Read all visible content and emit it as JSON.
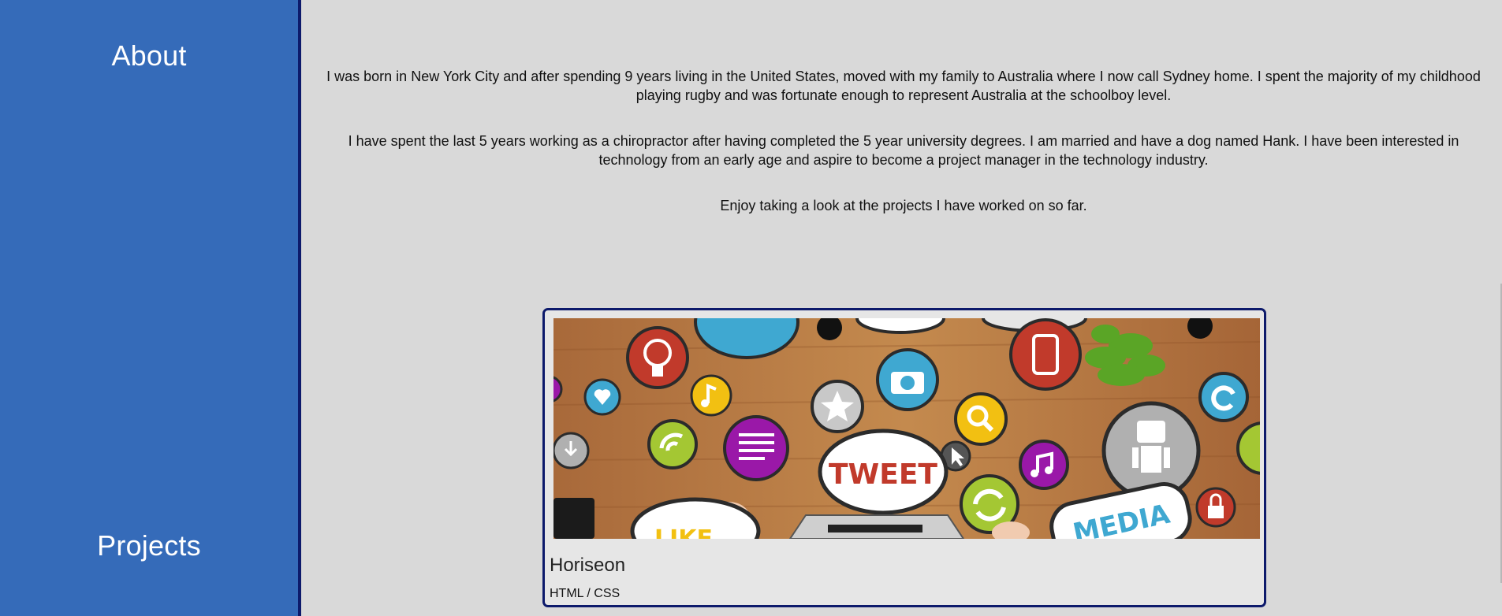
{
  "sidebar": {
    "about_label": "About",
    "projects_label": "Projects"
  },
  "about": {
    "paragraphs": [
      "I was born in New York City and after spending 9 years living in the United States, moved with my family to Australia where I now call Sydney home. I spent the majority of my childhood playing rugby and was fortunate enough to represent Australia at the schoolboy level.",
      "I have spent the last 5 years working as a chiropractor after having completed the 5 year university degrees. I am married and have a dog named Hank. I have been interested in technology from an early age and aspire to become a project manager in the technology industry.",
      "Enjoy taking a look at the projects I have worked on so far."
    ]
  },
  "projects": [
    {
      "title": "Horiseon",
      "tags": "HTML / CSS",
      "image": {
        "icon": "social-media-icons-desk-photo",
        "tweet_text": "TWEET",
        "media_text": "MEDIA",
        "like_text": "LIKE"
      }
    }
  ],
  "colors": {
    "sidebar": "#356bb9",
    "border": "#0d1a6b",
    "background": "#d9d9d9"
  }
}
